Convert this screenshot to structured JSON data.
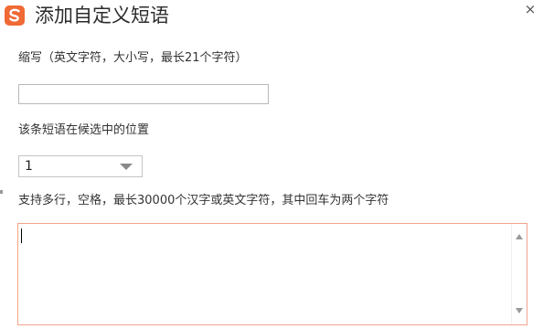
{
  "dialog": {
    "title": "添加自定义短语",
    "close_glyph": "×",
    "logo_icon": "sogou-s-icon",
    "accent_color": "#f06a35"
  },
  "abbreviation": {
    "label": "缩写（英文字符，大小写，最长21个字符）",
    "value": "",
    "placeholder": ""
  },
  "position": {
    "label": "该条短语在候选中的位置",
    "selected": "1"
  },
  "content": {
    "label": "支持多行，空格，最长30000个汉字或英文字符，其中回车为两个字符",
    "value": "",
    "border_color": "#f2a48a"
  }
}
